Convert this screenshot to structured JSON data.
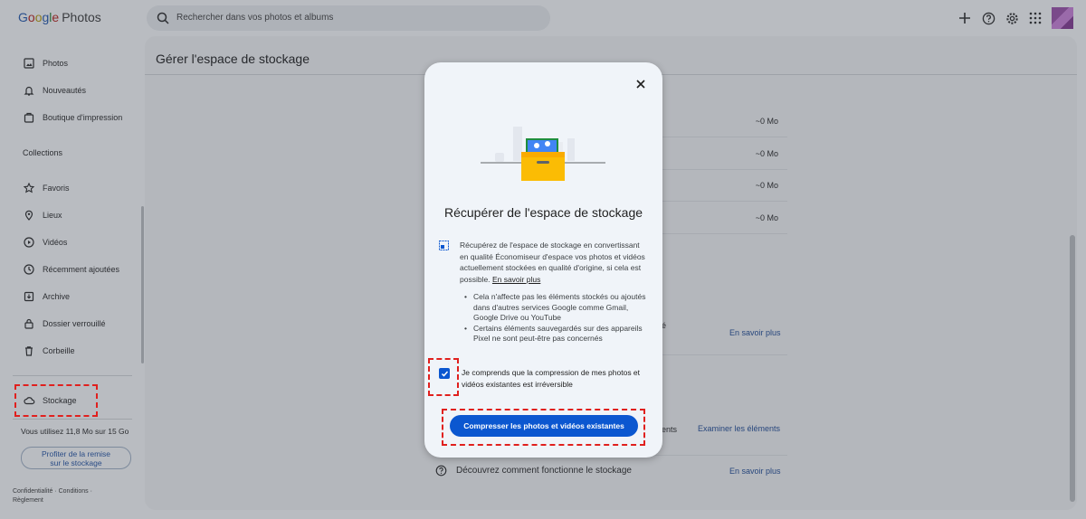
{
  "app": {
    "logo_google": [
      "G",
      "o",
      "o",
      "g",
      "l",
      "e"
    ],
    "logo_product": "Photos"
  },
  "search": {
    "placeholder": "Rechercher dans vos photos et albums"
  },
  "top_icons": [
    "add-icon",
    "help-icon",
    "settings-icon",
    "apps-icon",
    "avatar"
  ],
  "sidebar": {
    "items": [
      {
        "label": "Photos",
        "icon": "photo-icon"
      },
      {
        "label": "Nouveautés",
        "icon": "bell-icon"
      },
      {
        "label": "Boutique d'impression",
        "icon": "print-shop-icon"
      }
    ],
    "collections_label": "Collections",
    "collection_items": [
      {
        "label": "Favoris",
        "icon": "star-icon"
      },
      {
        "label": "Lieux",
        "icon": "location-icon"
      },
      {
        "label": "Vidéos",
        "icon": "play-icon"
      },
      {
        "label": "Récemment ajoutées",
        "icon": "clock-icon"
      },
      {
        "label": "Archive",
        "icon": "archive-icon"
      },
      {
        "label": "Dossier verrouillé",
        "icon": "lock-icon"
      },
      {
        "label": "Corbeille",
        "icon": "trash-icon"
      }
    ],
    "storage_label": "Stockage",
    "usage": "Vous utilisez 11,8 Mo sur 15 Go",
    "promo_line1": "Profiter de la remise",
    "promo_line2": "sur le stockage",
    "footer_privacy": "Confidentialité",
    "footer_terms": "Conditions",
    "footer_rules": "Règlement"
  },
  "main": {
    "title": "Gérer l'espace de stockage",
    "values": [
      "~0 Mo",
      "~0 Mo",
      "~0 Mo",
      "~0 Mo"
    ],
    "partial_e": "é",
    "partial_ents": "ents",
    "link_learn1": "En savoir plus",
    "link_review": "Examiner les éléments",
    "help_text": "Découvrez comment fonctionne le stockage",
    "link_learn2": "En savoir plus"
  },
  "dialog": {
    "title": "Récupérer de l'espace de stockage",
    "body": "Récupérez de l'espace de stockage en convertissant en qualité Économiseur d'espace vos photos et vidéos actuellement stockées en qualité d'origine, si cela est possible.",
    "learn_more": "En savoir plus",
    "bullets": [
      "Cela n'affecte pas les éléments stockés ou ajoutés dans d'autres services Google comme Gmail, Google Drive ou YouTube",
      "Certains éléments sauvegardés sur des appareils Pixel ne sont peut-être pas concernés"
    ],
    "checkbox_label": "Je comprends que la compression de mes photos et vidéos existantes est irréversible",
    "checkbox_checked": true,
    "button_label": "Compresser les photos et vidéos existantes",
    "accent_color": "#0b57d0",
    "annotation_color": "#e0201e"
  }
}
